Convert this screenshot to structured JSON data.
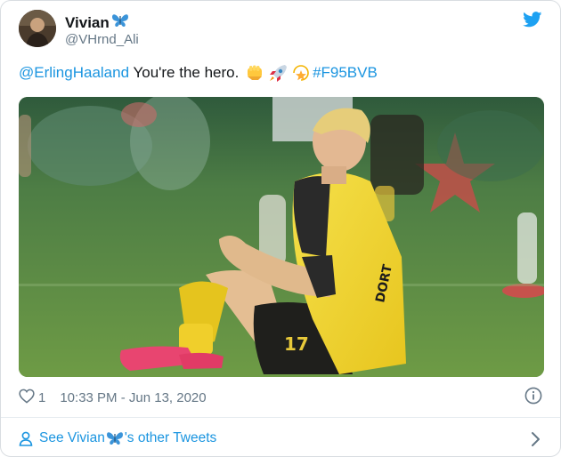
{
  "author": {
    "display_name": "Vivian",
    "handle": "@VHrnd_Ali"
  },
  "tweet": {
    "mention": "@ErlingHaaland",
    "text": " You're the hero. ",
    "hashtag": "#F95BVB"
  },
  "meta": {
    "like_count": "1",
    "timestamp": "10:33 PM - Jun 13, 2020"
  },
  "footer": {
    "see_prefix": "See Vivian",
    "see_suffix": "'s other Tweets"
  },
  "media": {
    "jersey_text": "DORT",
    "shorts_number": "17"
  },
  "icons": [
    "butterfly-icon",
    "twitter-bird-icon",
    "fist-emoji-icon",
    "rocket-emoji-icon",
    "dizzy-star-emoji-icon",
    "heart-icon",
    "info-icon",
    "person-icon",
    "chevron-right-icon"
  ],
  "colors": {
    "link": "#1b95e0",
    "secondary_text": "#657786",
    "twitter_blue": "#1da1f2"
  }
}
